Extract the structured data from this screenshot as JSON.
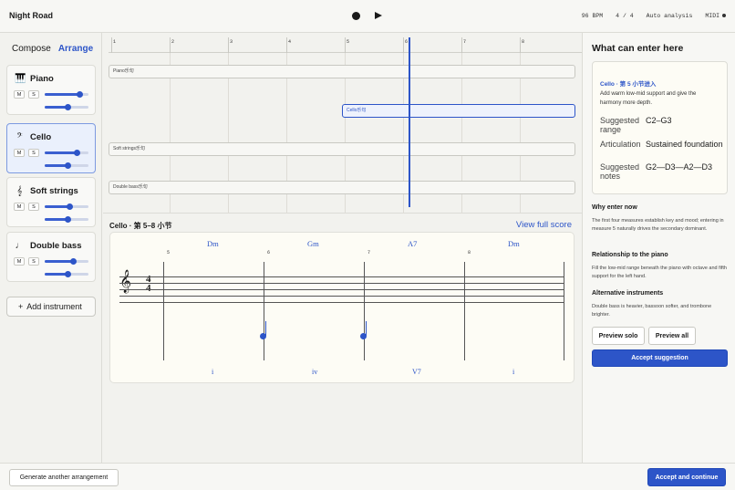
{
  "app": {
    "title": "Night Road"
  },
  "status": {
    "bpm": "96 BPM",
    "time_sig": "4 / 4",
    "analysis": "Auto analysis",
    "midi": "MIDI"
  },
  "sidebar": {
    "tabs": [
      {
        "label": "Compose"
      },
      {
        "label": "Arrange"
      }
    ],
    "tracks": [
      {
        "name": "Piano",
        "icon": "piano-icon",
        "glyph": "🎹"
      },
      {
        "name": "Cello",
        "icon": "bass-clef-icon",
        "glyph": "𝄢"
      },
      {
        "name": "Soft strings",
        "icon": "violin-icon",
        "glyph": "𝄞"
      },
      {
        "name": "Double bass",
        "icon": "note-icon",
        "glyph": "♩"
      }
    ],
    "mute_label": "M",
    "solo_label": "S",
    "add_instrument": "Add instrument"
  },
  "timeline": {
    "measures": [
      "1",
      "2",
      "3",
      "4",
      "5",
      "6",
      "7",
      "8"
    ],
    "lanes": [
      {
        "label": "Piano乐句"
      },
      {
        "label": "Cello乐句"
      },
      {
        "label": "Soft strings乐句"
      },
      {
        "label": "Double bass乐句"
      }
    ]
  },
  "score": {
    "header": "Cello · 第 5–8 小节",
    "view_full": "View full score",
    "chords": [
      "Dm",
      "Gm",
      "A7",
      "Dm"
    ],
    "romans": [
      "i",
      "iv",
      "V7",
      "i"
    ],
    "measure_numbers": [
      "5",
      "6",
      "7",
      "8"
    ],
    "time_sig_top": "4",
    "time_sig_bottom": "4",
    "clef": "𝄞"
  },
  "panel": {
    "title": "What can enter here",
    "suggestion": {
      "title": "Cello · 第 5 小节进入",
      "desc": "Add warm low-mid support and give the harmony more depth.",
      "rows": [
        {
          "key": "Suggested range",
          "value": "C2–G3"
        },
        {
          "key": "Articulation",
          "value": "Sustained foundation"
        },
        {
          "key": "Suggested notes",
          "value": "G2—D3—A2—D3"
        }
      ]
    },
    "sections": [
      {
        "title": "Why enter now",
        "body": "The first four measures establish key and mood; entering in measure 5 naturally drives the secondary dominant."
      },
      {
        "title": "Relationship to the piano",
        "body": "Fill the low-mid range beneath the piano with octave and fifth support for the left hand."
      },
      {
        "title": "Alternative instruments",
        "body": "Double bass is heavier, bassoon softer, and trombone brighter."
      }
    ],
    "preview_solo": "Preview solo",
    "preview_all": "Preview all",
    "accept": "Accept suggestion"
  },
  "footer": {
    "generate": "Generate another arrangement",
    "accept_continue": "Accept and continue"
  },
  "colors": {
    "accent": "#2d55c8",
    "paper": "#fdfcf5",
    "background": "#f2f2ee"
  }
}
